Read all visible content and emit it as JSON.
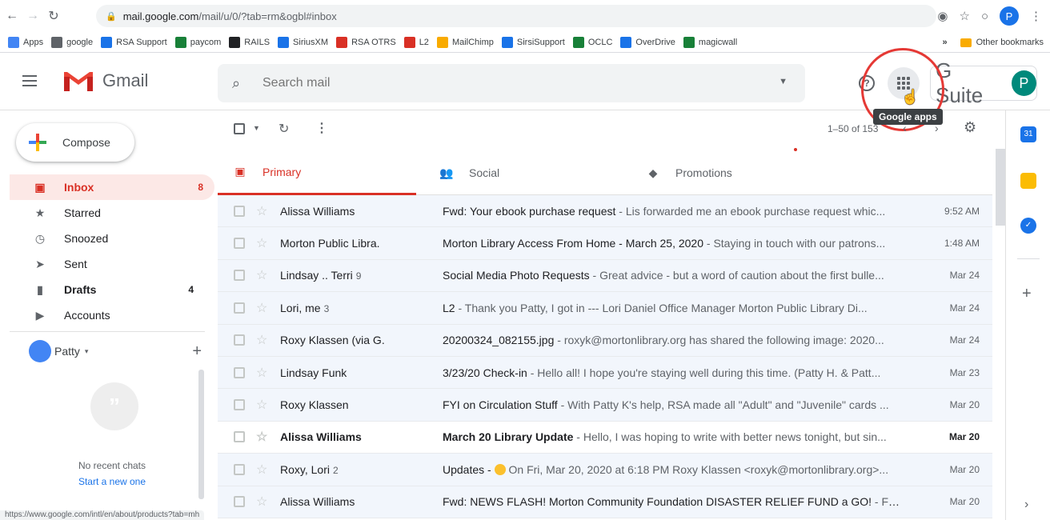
{
  "browser": {
    "url_host": "mail.google.com",
    "url_path": "/mail/u/0/?tab=rm&ogbl#inbox",
    "profile_initial": "P",
    "bookmarks": [
      {
        "label": "Apps",
        "color": "#4285f4"
      },
      {
        "label": "google",
        "color": "#5f6368"
      },
      {
        "label": "RSA Support",
        "color": "#1a73e8"
      },
      {
        "label": "paycom",
        "color": "#188038"
      },
      {
        "label": "RAILS",
        "color": "#202124"
      },
      {
        "label": "SiriusXM",
        "color": "#1a73e8"
      },
      {
        "label": "RSA OTRS",
        "color": "#d93025"
      },
      {
        "label": "L2",
        "color": "#d93025"
      },
      {
        "label": "MailChimp",
        "color": "#f9ab00"
      },
      {
        "label": "SirsiSupport",
        "color": "#1a73e8"
      },
      {
        "label": "OCLC",
        "color": "#188038"
      },
      {
        "label": "OverDrive",
        "color": "#1a73e8"
      },
      {
        "label": "magicwall",
        "color": "#188038"
      }
    ],
    "more_bookmarks": "»",
    "other_bookmarks": "Other bookmarks",
    "status_url": "https://www.google.com/intl/en/about/products?tab=mh"
  },
  "header": {
    "app_name": "Gmail",
    "search_placeholder": "Search mail",
    "help": "?",
    "tooltip": "Google apps",
    "gsuite_label": "G Suite",
    "avatar_initial": "P"
  },
  "compose_label": "Compose",
  "nav": [
    {
      "label": "Inbox",
      "count": "8",
      "icon": "inbox-icon",
      "active": true
    },
    {
      "label": "Starred",
      "count": "",
      "icon": "star-icon"
    },
    {
      "label": "Snoozed",
      "count": "",
      "icon": "clock-icon"
    },
    {
      "label": "Sent",
      "count": "",
      "icon": "send-icon"
    },
    {
      "label": "Drafts",
      "count": "4",
      "icon": "draft-icon",
      "bold": true
    },
    {
      "label": "Accounts",
      "count": "",
      "icon": "label-icon"
    }
  ],
  "hangouts": {
    "user": "Patty",
    "no_chats": "No recent chats",
    "start_new": "Start a new one"
  },
  "toolbar": {
    "range": "1–50 of 153"
  },
  "tabs": [
    {
      "label": "Primary",
      "icon": "inbox-icon",
      "active": true
    },
    {
      "label": "Social",
      "icon": "people-icon"
    },
    {
      "label": "Promotions",
      "icon": "tag-icon"
    }
  ],
  "emails": [
    {
      "sender": "Alissa Williams",
      "count": "",
      "subject": "Fwd: Your ebook purchase request",
      "snippet": " - Lis forwarded me an ebook purchase request whic...",
      "date": "9:52 AM",
      "unread": false
    },
    {
      "sender": "Morton Public Libra.",
      "count": "",
      "subject": "Morton Library Access From Home - March 25, 2020",
      "snippet": " - Staying in touch with our patrons...",
      "date": "1:48 AM",
      "unread": false
    },
    {
      "sender": "Lindsay .. Terri",
      "count": "9",
      "subject": "Social Media Photo Requests",
      "snippet": " - Great advice - but a word of caution about the first bulle...",
      "date": "Mar 24",
      "unread": false
    },
    {
      "sender": "Lori, me",
      "count": "3",
      "subject": "L2",
      "snippet": " - Thank you Patty, I got in --- Lori Daniel Office Manager Morton Public Library Di...",
      "date": "Mar 24",
      "unread": false
    },
    {
      "sender": "Roxy Klassen (via G.",
      "count": "",
      "subject": "20200324_082155.jpg",
      "snippet": " - roxyk@mortonlibrary.org has shared the following image: 2020...",
      "date": "Mar 24",
      "unread": false
    },
    {
      "sender": "Lindsay Funk",
      "count": "",
      "subject": "3/23/20 Check-in",
      "snippet": " - Hello all! I hope you're staying well during this time. (Patty H. & Patt...",
      "date": "Mar 23",
      "unread": false
    },
    {
      "sender": "Roxy Klassen",
      "count": "",
      "subject": "FYI on Circulation Stuff",
      "snippet": " - With Patty K's help, RSA made all \"Adult\" and \"Juvenile\" cards ...",
      "date": "Mar 20",
      "unread": false
    },
    {
      "sender": "Alissa Williams",
      "count": "",
      "subject": "March 20 Library Update",
      "snippet": " - Hello, I was hoping to write with better news tonight, but sin...",
      "date": "Mar 20",
      "unread": true
    },
    {
      "sender": "Roxy, Lori",
      "count": "2",
      "subject": "Updates",
      "snippet": " - On Fri, Mar 20, 2020 at 6:18 PM Roxy Klassen <roxyk@mortonlibrary.org>...",
      "date": "Mar 20",
      "unread": false
    },
    {
      "sender": "Alissa Williams",
      "count": "",
      "subject": "Fwd: NEWS FLASH! Morton Community Foundation DISASTER RELIEF FUND a GO!",
      "snippet": " - FYI...",
      "date": "Mar 20",
      "unread": false
    }
  ],
  "side_panel": {
    "calendar_day": "31"
  },
  "colors": {
    "accent_red": "#d93025",
    "link_blue": "#1a73e8",
    "annotation_circle": "#e53935"
  }
}
